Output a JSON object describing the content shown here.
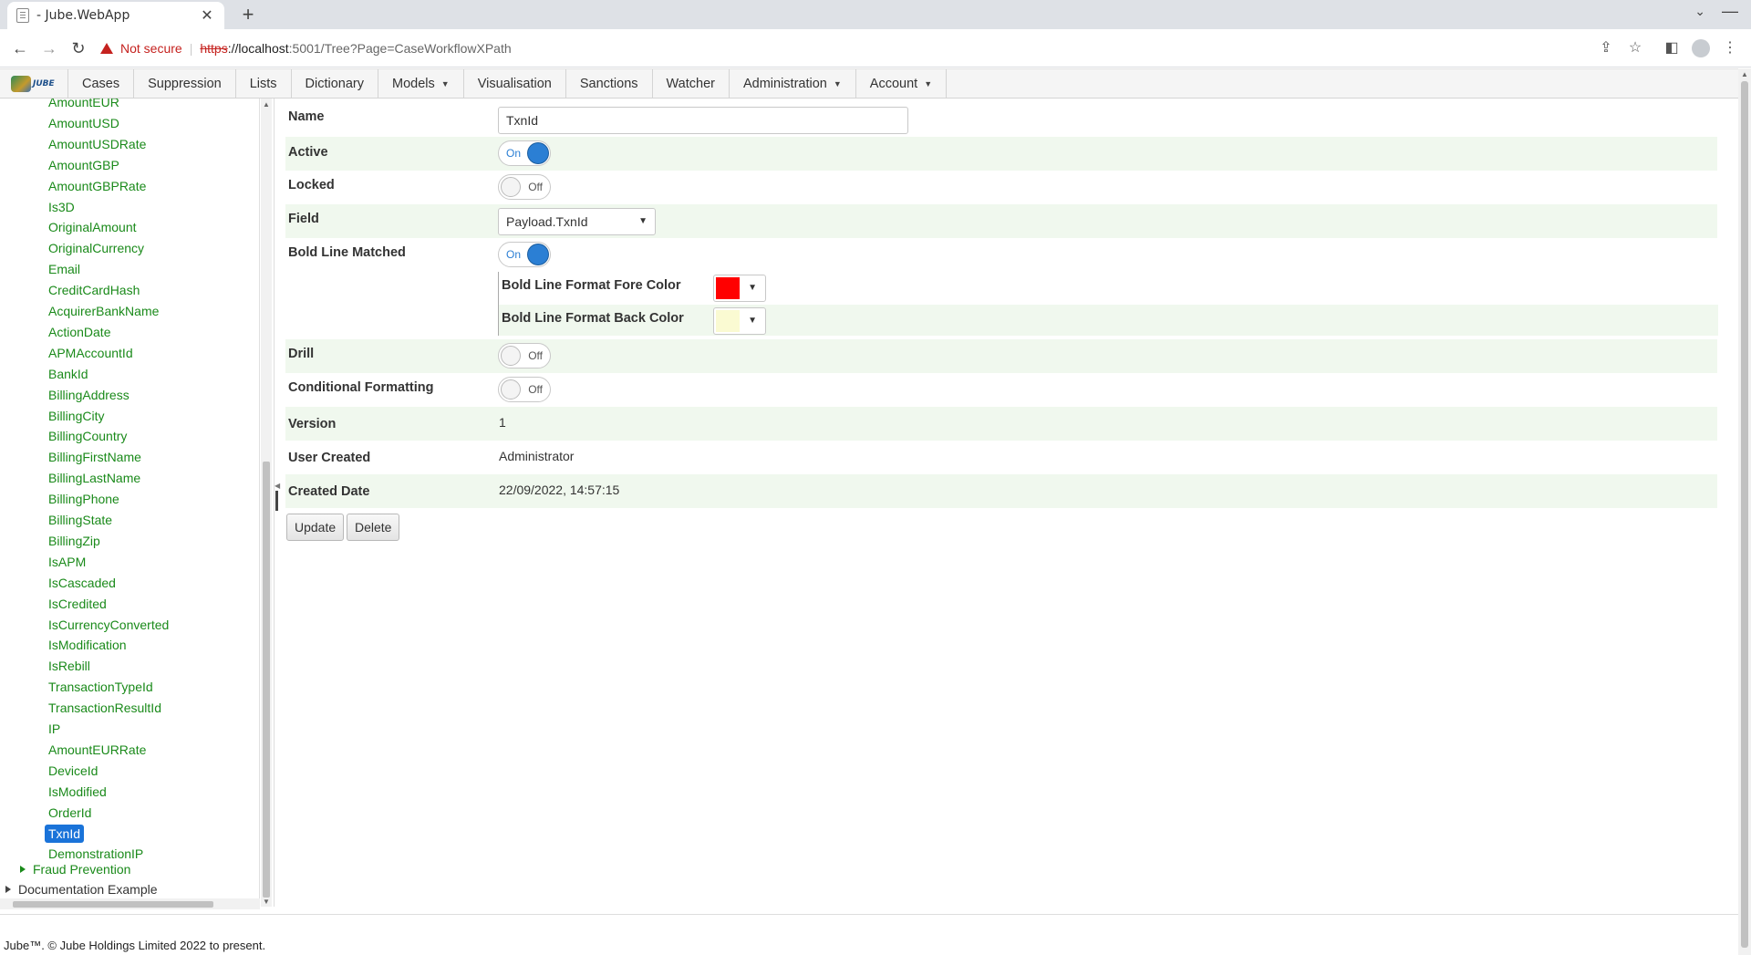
{
  "browser": {
    "tab_title": "- Jube.WebApp",
    "tab_close": "✕",
    "new_tab": "+",
    "not_secure": "Not secure",
    "url_scheme": "https",
    "url_host": "://localhost",
    "url_path": ":5001/Tree?Page=CaseWorkflowXPath"
  },
  "nav": {
    "logo_text": "JUBE",
    "items": [
      {
        "label": "Cases",
        "dropdown": false
      },
      {
        "label": "Suppression",
        "dropdown": false
      },
      {
        "label": "Lists",
        "dropdown": false
      },
      {
        "label": "Dictionary",
        "dropdown": false
      },
      {
        "label": "Models",
        "dropdown": true
      },
      {
        "label": "Visualisation",
        "dropdown": false
      },
      {
        "label": "Sanctions",
        "dropdown": false
      },
      {
        "label": "Watcher",
        "dropdown": false
      },
      {
        "label": "Administration",
        "dropdown": true
      },
      {
        "label": "Account",
        "dropdown": true
      }
    ]
  },
  "tree": {
    "nodes": [
      "AmountEUR",
      "AmountUSD",
      "AmountUSDRate",
      "AmountGBP",
      "AmountGBPRate",
      "Is3D",
      "OriginalAmount",
      "OriginalCurrency",
      "Email",
      "CreditCardHash",
      "AcquirerBankName",
      "ActionDate",
      "APMAccountId",
      "BankId",
      "BillingAddress",
      "BillingCity",
      "BillingCountry",
      "BillingFirstName",
      "BillingLastName",
      "BillingPhone",
      "BillingState",
      "BillingZip",
      "IsAPM",
      "IsCascaded",
      "IsCredited",
      "IsCurrencyConverted",
      "IsModification",
      "IsRebill",
      "TransactionTypeId",
      "TransactionResultId",
      "IP",
      "AmountEURRate",
      "DeviceId",
      "IsModified",
      "OrderId",
      "TxnId",
      "DemonstrationIP"
    ],
    "selected": "TxnId",
    "groups": [
      {
        "label": "Fraud Prevention",
        "color": "green"
      },
      {
        "label": "Documentation Example",
        "color": "dark"
      }
    ]
  },
  "form": {
    "name_label": "Name",
    "name_value": "TxnId",
    "active_label": "Active",
    "active_state": "On",
    "locked_label": "Locked",
    "locked_state": "Off",
    "field_label": "Field",
    "field_value": "Payload.TxnId",
    "bold_label": "Bold Line Matched",
    "bold_state": "On",
    "fore_color_label": "Bold Line Format Fore Color",
    "fore_color": "#ff0000",
    "back_color_label": "Bold Line Format Back Color",
    "back_color": "#fafad2",
    "drill_label": "Drill",
    "drill_state": "Off",
    "cond_label": "Conditional Formatting",
    "cond_state": "Off",
    "version_label": "Version",
    "version_value": "1",
    "user_label": "User Created",
    "user_value": "Administrator",
    "date_label": "Created Date",
    "date_value": "22/09/2022, 14:57:15",
    "update_button": "Update",
    "delete_button": "Delete"
  },
  "footer": {
    "text": "Jube™. © Jube Holdings Limited 2022 to present."
  }
}
